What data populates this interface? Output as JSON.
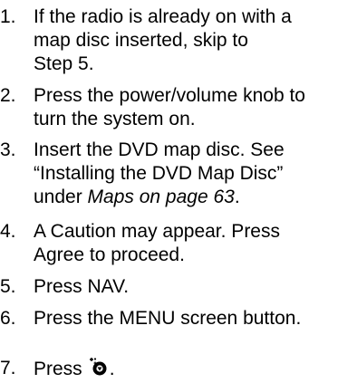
{
  "steps": [
    {
      "number": "1.",
      "lines": [
        "If the radio is already on with a",
        "map disc inserted, skip to",
        "Step 5."
      ]
    },
    {
      "number": "2.",
      "lines": [
        "Press the power/volume knob to",
        "turn the system on."
      ]
    },
    {
      "number": "3.",
      "lines": [
        "Insert the DVD map disc. See",
        "“Installing the DVD Map Disc”"
      ],
      "last_line_prefix": "under ",
      "last_line_italic": "Maps on page 63",
      "last_line_suffix": "."
    },
    {
      "number": "4.",
      "lines": [
        "A Caution may appear. Press",
        "Agree to proceed."
      ]
    },
    {
      "number": "5.",
      "lines": [
        "Press NAV."
      ]
    },
    {
      "number": "6.",
      "lines": [
        "Press the MENU screen button."
      ]
    },
    {
      "number": "7.",
      "lines": [
        "Press"
      ],
      "icon": "navigation-button-icon",
      "suffix": "."
    }
  ]
}
